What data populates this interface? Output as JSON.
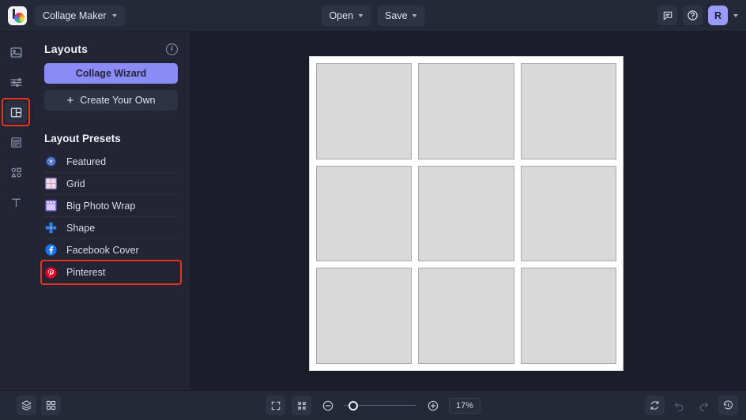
{
  "header": {
    "logo_icon": "bazaart-logo-icon",
    "doc_title": "Collage Maker",
    "doc_title_chevron": "chevron-down-icon",
    "open_label": "Open",
    "save_label": "Save",
    "comment_icon": "comment-icon",
    "help_icon": "help-circle-icon",
    "avatar_initial": "R",
    "avatar_chevron": "chevron-down-icon"
  },
  "rail": {
    "items": [
      {
        "name": "photos",
        "icon": "image-icon",
        "active": false
      },
      {
        "name": "adjust",
        "icon": "sliders-icon",
        "active": false
      },
      {
        "name": "layouts",
        "icon": "layouts-icon",
        "active": true
      },
      {
        "name": "templates",
        "icon": "template-lines-icon",
        "active": false
      },
      {
        "name": "elements",
        "icon": "shapes-icon",
        "active": false
      },
      {
        "name": "text",
        "icon": "text-t-icon",
        "active": false
      }
    ]
  },
  "panel": {
    "title": "Layouts",
    "info_icon": "info-circle-icon",
    "collage_wizard_label": "Collage Wizard",
    "create_your_own_label": "Create Your Own",
    "create_your_own_icon": "plus-icon",
    "presets_title": "Layout Presets",
    "presets": [
      {
        "label": "Featured",
        "icon": "featured-badge-icon",
        "selected": false
      },
      {
        "label": "Grid",
        "icon": "grid-icon",
        "selected": false
      },
      {
        "label": "Big Photo Wrap",
        "icon": "big-photo-wrap-icon",
        "selected": false
      },
      {
        "label": "Shape",
        "icon": "shape-cross-icon",
        "selected": false
      },
      {
        "label": "Facebook Cover",
        "icon": "facebook-icon",
        "selected": false
      },
      {
        "label": "Pinterest",
        "icon": "pinterest-icon",
        "selected": true
      }
    ]
  },
  "canvas": {
    "rows": 3,
    "columns": 3,
    "cells": 9
  },
  "footer": {
    "layers_icon": "layers-icon",
    "grid_view_icon": "grid-view-icon",
    "fullscreen_icon": "expand-icon",
    "fit_screen_icon": "collapse-icon",
    "zoom_out_icon": "minus-circle-icon",
    "zoom_in_icon": "plus-circle-icon",
    "zoom_value": "17%",
    "reset_icon": "reset-icon",
    "undo_icon": "undo-icon",
    "redo_icon": "redo-icon",
    "history_icon": "history-icon"
  },
  "colors": {
    "accent": "#8b8bf6",
    "highlight": "#e8331c",
    "panel_bg": "#232534",
    "chrome_bg": "#252836",
    "canvas_bg": "#1b1d2a",
    "board": "#ffffff",
    "cell": "#d9d9d9"
  }
}
